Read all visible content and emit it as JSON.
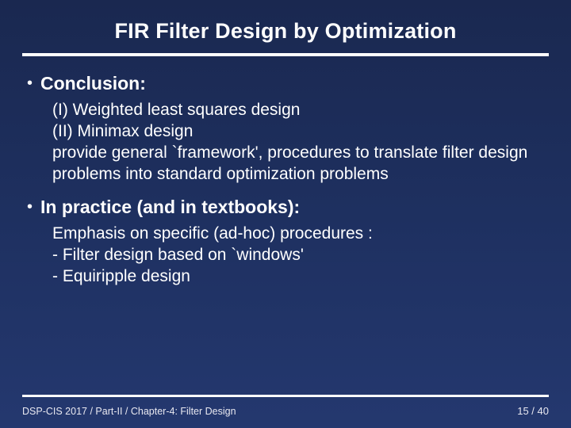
{
  "title": "FIR Filter Design by Optimization",
  "bullets": [
    {
      "head": "Conclusion:",
      "lines": [
        "(I) Weighted least squares design",
        "(II) Minimax design",
        "provide general `framework', procedures to translate filter design problems into standard optimization problems"
      ]
    },
    {
      "head": "In practice (and in textbooks):",
      "lines": [
        "Emphasis on specific (ad-hoc) procedures :",
        "- Filter design based on `windows'",
        "- Equiripple design"
      ]
    }
  ],
  "footer": {
    "left": "DSP-CIS 2017  /  Part-II  /  Chapter-4: Filter Design",
    "page": "15 / 40"
  }
}
